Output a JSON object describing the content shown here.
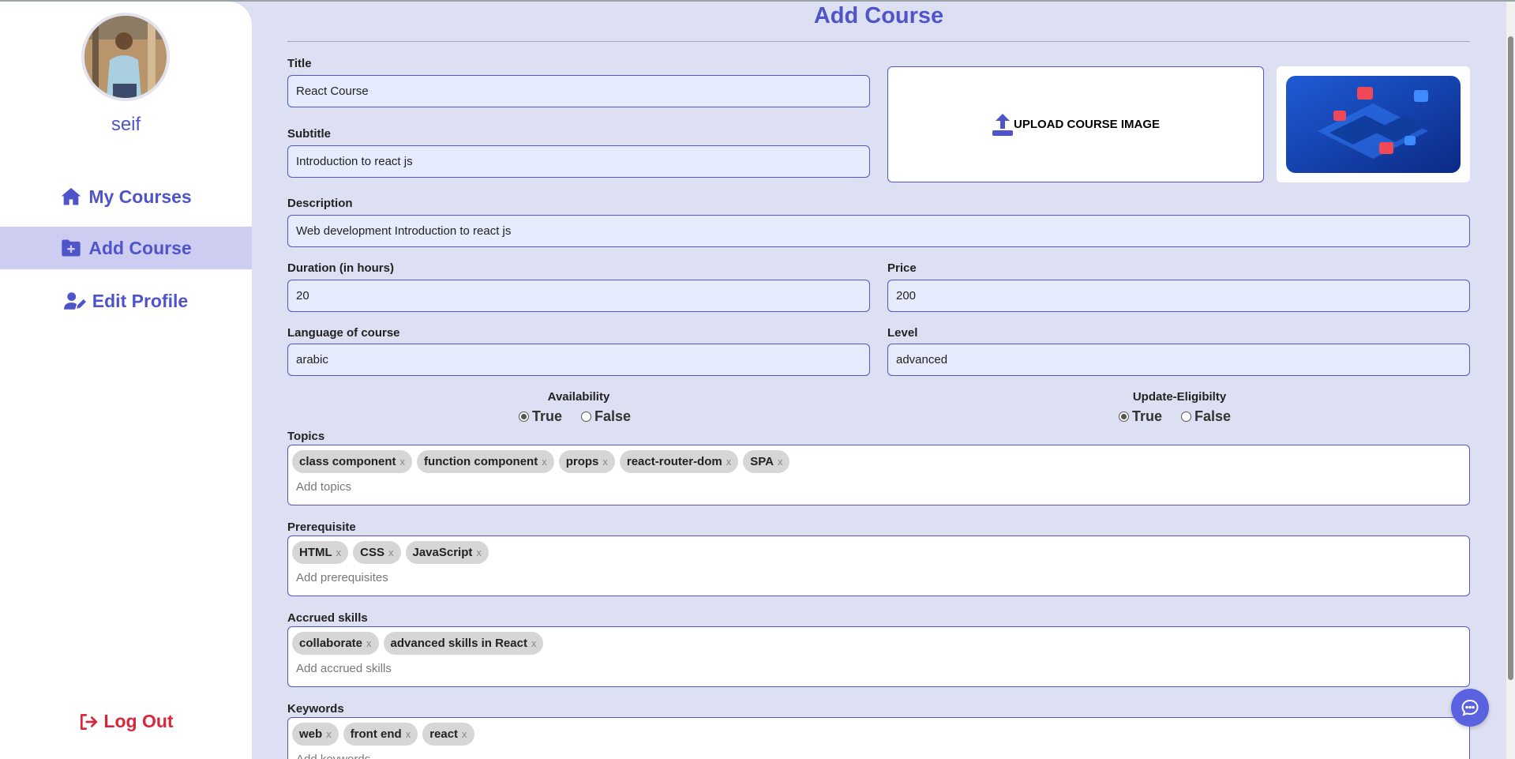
{
  "sidebar": {
    "username": "seif",
    "nav": [
      {
        "label": "My Courses",
        "icon": "home-icon"
      },
      {
        "label": "Add Course",
        "icon": "folder-plus-icon"
      },
      {
        "label": "Edit Profile",
        "icon": "user-edit-icon"
      }
    ],
    "logout_label": "Log Out"
  },
  "page": {
    "title": "Add Course"
  },
  "form": {
    "title": {
      "label": "Title",
      "value": "React Course"
    },
    "subtitle": {
      "label": "Subtitle",
      "value": "Introduction to react js"
    },
    "upload_label": "UPLOAD COURSE IMAGE",
    "description": {
      "label": "Description",
      "value": "Web development Introduction to react js"
    },
    "duration": {
      "label": "Duration (in hours)",
      "value": "20"
    },
    "price": {
      "label": "Price",
      "value": "200"
    },
    "language": {
      "label": "Language of course",
      "value": "arabic"
    },
    "level": {
      "label": "Level",
      "value": "advanced"
    },
    "availability": {
      "label": "Availability",
      "options": [
        "True",
        "False"
      ],
      "selected": "True"
    },
    "update_eligibility": {
      "label": "Update-Eligibilty",
      "options": [
        "True",
        "False"
      ],
      "selected": "True"
    },
    "topics": {
      "label": "Topics",
      "tags": [
        "class component",
        "function component",
        "props",
        "react-router-dom",
        "SPA"
      ],
      "placeholder": "Add topics"
    },
    "prerequisite": {
      "label": "Prerequisite",
      "tags": [
        "HTML",
        "CSS",
        "JavaScript"
      ],
      "placeholder": "Add prerequisites"
    },
    "accrued_skills": {
      "label": "Accrued skills",
      "tags": [
        "collaborate",
        "advanced skills in React"
      ],
      "placeholder": "Add accrued skills"
    },
    "keywords": {
      "label": "Keywords",
      "tags": [
        "web",
        "front end",
        "react"
      ],
      "placeholder": "Add keywords"
    }
  },
  "tag_remove_glyph": "x",
  "colors": {
    "accent": "#4f55c9",
    "background": "#dddff3",
    "active_nav": "#cccdf1",
    "logout": "#d9263a",
    "chat_button": "#5b62e0"
  }
}
